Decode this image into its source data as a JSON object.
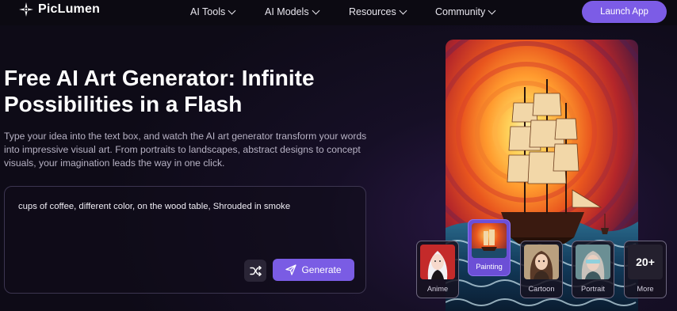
{
  "brand": {
    "name": "PicLumen"
  },
  "nav": {
    "items": [
      {
        "label": "AI Tools"
      },
      {
        "label": "AI Models"
      },
      {
        "label": "Resources"
      },
      {
        "label": "Community"
      }
    ],
    "launch_label": "Launch App"
  },
  "hero": {
    "title_line1": "Free AI Art Generator: Infinite",
    "title_line2": "Possibilities in a Flash",
    "description": "Type your idea into the text box, and watch the AI art generator transform your words into impressive visual art. From portraits to landscapes, abstract designs to concept visuals, your imagination leads the way in one click."
  },
  "prompt": {
    "value": "cups of coffee, different color, on the wood table, Shrouded in smoke",
    "generate_label": "Generate"
  },
  "styles": {
    "items": [
      {
        "label": "Anime",
        "icon": "anime-portrait-thumb"
      },
      {
        "label": "Painting",
        "icon": "painting-ship-thumb",
        "selected": true
      },
      {
        "label": "Cartoon",
        "icon": "cartoon-portrait-thumb"
      },
      {
        "label": "Portrait",
        "icon": "portrait-thumb"
      }
    ],
    "more_count": "20+",
    "more_label": "More"
  },
  "colors": {
    "accent": "#7c5ce6",
    "background": "#0e0b17"
  }
}
